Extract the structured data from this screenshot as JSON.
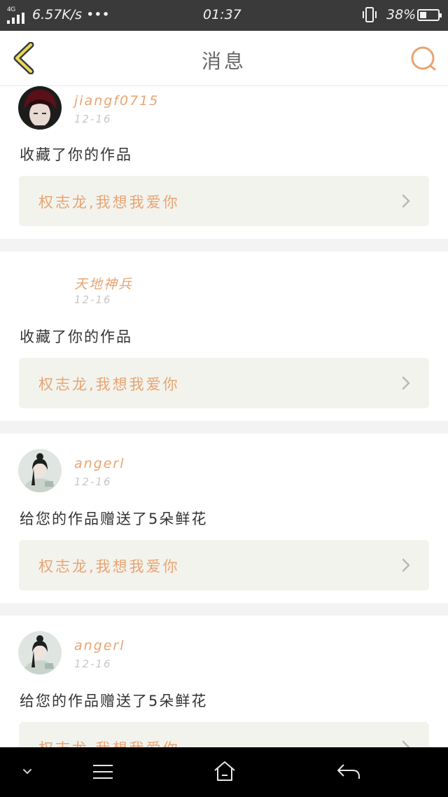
{
  "status_bar": {
    "network": "4G",
    "speed": "6.57K/s •••",
    "time": "01:37",
    "battery_percent": "38%",
    "battery_level": 0.38
  },
  "header": {
    "title": "消息",
    "back_icon": "chevron-left-icon",
    "search_icon": "search-icon",
    "accent_color": "#e8a472"
  },
  "messages": [
    {
      "username": "jiangf0715",
      "date": "12-16",
      "action": "收藏了你的作品",
      "work_title": "权志龙,我想我爱你",
      "avatar": "dark-hair-portrait"
    },
    {
      "username": "天地神兵",
      "date": "12-16",
      "action": "收藏了你的作品",
      "work_title": "权志龙,我想我爱你",
      "avatar": "blank"
    },
    {
      "username": "angerl",
      "date": "12-16",
      "action": "给您的作品赠送了5朵鲜花",
      "work_title": "权志龙,我想我爱你",
      "avatar": "girl-with-bun"
    },
    {
      "username": "angerl",
      "date": "12-16",
      "action": "给您的作品赠送了5朵鲜花",
      "work_title": "权志龙,我想我爱你",
      "avatar": "girl-with-bun"
    }
  ],
  "system_nav": {
    "icons": [
      "chevron-down-icon",
      "menu-icon",
      "home-icon",
      "back-arrow-icon"
    ]
  }
}
